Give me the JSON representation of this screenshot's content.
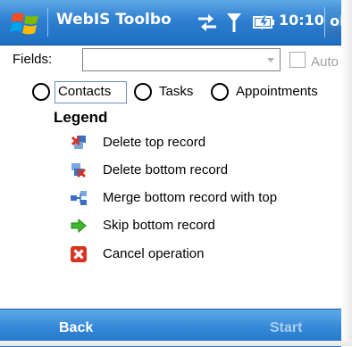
{
  "titlebar": {
    "title": "WebIS Toolbo",
    "time": "10:10",
    "ok_label": "ok",
    "icons": [
      "windows-start-icon",
      "sync-icon",
      "signal-icon",
      "battery-icon"
    ]
  },
  "fields": {
    "label": "Fields:",
    "selected_value": "",
    "auto_label": "Auto",
    "auto_checked": false,
    "auto_enabled": false
  },
  "types": {
    "options": [
      {
        "label": "Contacts",
        "selected": false
      },
      {
        "label": "Tasks",
        "selected": false
      },
      {
        "label": "Appointments",
        "selected": false
      }
    ]
  },
  "legend": {
    "title": "Legend",
    "items": [
      {
        "label": "Delete top record",
        "icon": "delete-top-record-icon"
      },
      {
        "label": "Delete bottom record",
        "icon": "delete-bottom-record-icon"
      },
      {
        "label": "Merge bottom record with top",
        "icon": "merge-records-icon"
      },
      {
        "label": "Skip bottom record",
        "icon": "skip-arrow-icon"
      },
      {
        "label": "Cancel operation",
        "icon": "cancel-x-icon"
      }
    ]
  },
  "softkeys": {
    "left": "Back",
    "right": "Start",
    "right_enabled": false
  },
  "colors": {
    "titlebar_blue": "#2e7fd0",
    "softbar_blue": "#3486d6",
    "disabled_text": "#a0a0a0",
    "skip_green": "#3dbb2c",
    "cancel_red": "#d8331e"
  }
}
